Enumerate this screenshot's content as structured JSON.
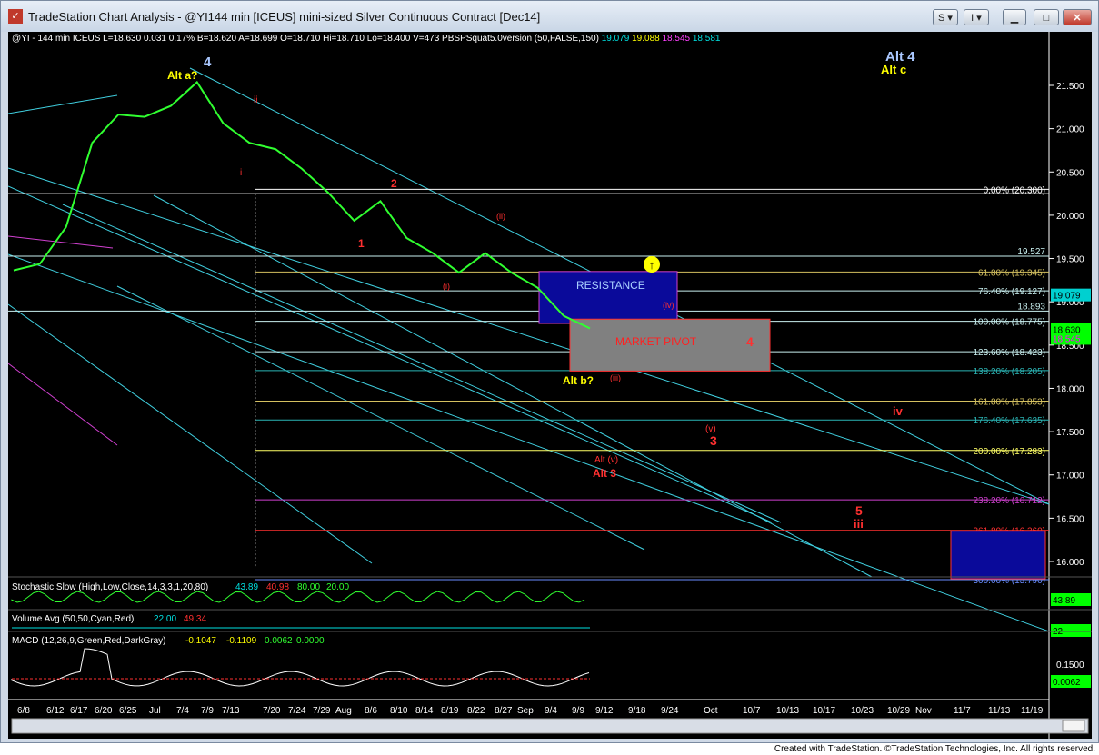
{
  "window": {
    "title": "TradeStation Chart Analysis - @YI144 min [ICEUS] mini-sized Silver Continuous Contract [Dec14]",
    "btn_s": "S",
    "btn_i": "I"
  },
  "status_line": {
    "symbol": "@YI - 144 min  ICEUS",
    "l": "L=18.630",
    "chg": "0.031",
    "pct": "0.17%",
    "b": "B=18.620",
    "a": "A=18.699",
    "o": "O=18.710",
    "hi": "Hi=18.710",
    "lo": "Lo=18.400",
    "v": "V=473",
    "study": "PBSPSquat5.0version (50,FALSE,150)",
    "v1": "19.079",
    "v2": "19.088",
    "v3": "18.545",
    "v4": "18.581"
  },
  "price_axis": [
    "21.500",
    "21.000",
    "20.500",
    "20.000",
    "19.500",
    "19.000",
    "18.500",
    "18.000",
    "17.500",
    "17.000",
    "16.500",
    "16.000"
  ],
  "price_markers": {
    "last": "19.079",
    "current": "18.630",
    "current2": "18.545"
  },
  "fib_levels": [
    {
      "label": "0.00% (20.300)",
      "value": 20.3,
      "color": "#ffffff"
    },
    {
      "label": "61.80% (19.345)",
      "value": 19.345,
      "color": "#d4c060"
    },
    {
      "label": "76.40% (19.127)",
      "value": 19.127,
      "color": "#c9f0f0"
    },
    {
      "label": "100.00% (18.775)",
      "value": 18.775,
      "color": "#c9f0f0"
    },
    {
      "label": "123.60% (18.423)",
      "value": 18.423,
      "color": "#c9f0f0"
    },
    {
      "label": "138.20% (18.205)",
      "value": 18.205,
      "color": "#2bb5b5"
    },
    {
      "label": "161.80% (17.853)",
      "value": 17.853,
      "color": "#d4c060"
    },
    {
      "label": "176.40% (17.635)",
      "value": 17.635,
      "color": "#2bb5b5"
    },
    {
      "label": "200.00% (17.283)",
      "value": 17.283,
      "color": "#ffff66"
    },
    {
      "label": "238.20% (16.712)",
      "value": 16.712,
      "color": "#d040d0"
    },
    {
      "label": "261.80% (16.360)",
      "value": 16.36,
      "color": "#ff3030"
    },
    {
      "label": "300.00% (15.790)",
      "value": 15.79,
      "color": "#6a8cff"
    }
  ],
  "extra_levels": {
    "l1": "19.527",
    "l2": "18.893"
  },
  "zones": {
    "resistance": "RESISTANCE",
    "market_pivot": "MARKET PIVOT"
  },
  "wave_labels": {
    "alt4": "Alt 4",
    "altc": "Alt c",
    "alta": "Alt a?",
    "w4": "4",
    "altb": "Alt b?",
    "altv": "Alt (v)",
    "alt3": "Alt 3",
    "r4": "4",
    "iv": "iv",
    "v": "(v)",
    "r3": "3",
    "r5": "5",
    "iii": "iii",
    "w1": "1",
    "w2": "2",
    "iv_small": "(iv)",
    "iii_small": "(iii)",
    "i_small": "(i)",
    "ii_small": "(ii)",
    "i_red": "i",
    "ii_red": "ii"
  },
  "indicators": {
    "stoch": {
      "label": "Stochastic Slow (High,Low,Close,14,3,3,1,20,80)",
      "v1": "43.89",
      "v2": "40.98",
      "v3": "80.00",
      "v4": "20.00",
      "axis": "43.89"
    },
    "volume": {
      "label": "Volume Avg (50,50,Cyan,Red)",
      "v1": "22.00",
      "v2": "49.34",
      "axis": "22"
    },
    "macd": {
      "label": "MACD (12,26,9,Green,Red,DarkGray)",
      "v1": "-0.1047",
      "v2": "-0.1109",
      "v3": "0.0062",
      "v4": "0.0000",
      "axis1": "0.1500",
      "axis2": "0.0062"
    }
  },
  "date_axis": [
    "6/8",
    "6/12",
    "6/17",
    "6/20",
    "6/25",
    "Jul",
    "7/4",
    "7/9",
    "7/13",
    "7/20",
    "7/24",
    "7/29",
    "Aug",
    "8/6",
    "8/10",
    "8/14",
    "8/19",
    "8/22",
    "8/27",
    "Sep",
    "9/4",
    "9/9",
    "9/12",
    "9/18",
    "9/24",
    "Oct",
    "10/7",
    "10/13",
    "10/17",
    "10/23",
    "10/29",
    "Nov",
    "11/7",
    "11/13",
    "11/19"
  ],
  "footer": "Created with TradeStation. ©TradeStation Technologies, Inc. All rights reserved.",
  "chart_data": {
    "type": "line",
    "title": "@YI144 min [ICEUS] mini-sized Silver Continuous Contract [Dec14]",
    "ylim": [
      15.8,
      21.8
    ],
    "x": [
      "6/8",
      "6/12",
      "6/17",
      "6/20",
      "6/25",
      "Jul",
      "7/4",
      "7/9",
      "7/13",
      "7/20",
      "7/24",
      "7/29",
      "Aug",
      "8/6",
      "8/10",
      "8/14",
      "8/19",
      "8/22",
      "8/27",
      "Sep",
      "9/4",
      "9/9",
      "9/12"
    ],
    "series": [
      {
        "values": [
          19.3,
          19.5,
          19.8,
          20.9,
          21.1,
          21.2,
          21.2,
          21.6,
          21.0,
          20.9,
          20.7,
          20.6,
          20.2,
          20.0,
          20.1,
          19.8,
          19.5,
          19.4,
          19.5,
          19.4,
          19.1,
          18.9,
          18.63
        ]
      }
    ]
  }
}
